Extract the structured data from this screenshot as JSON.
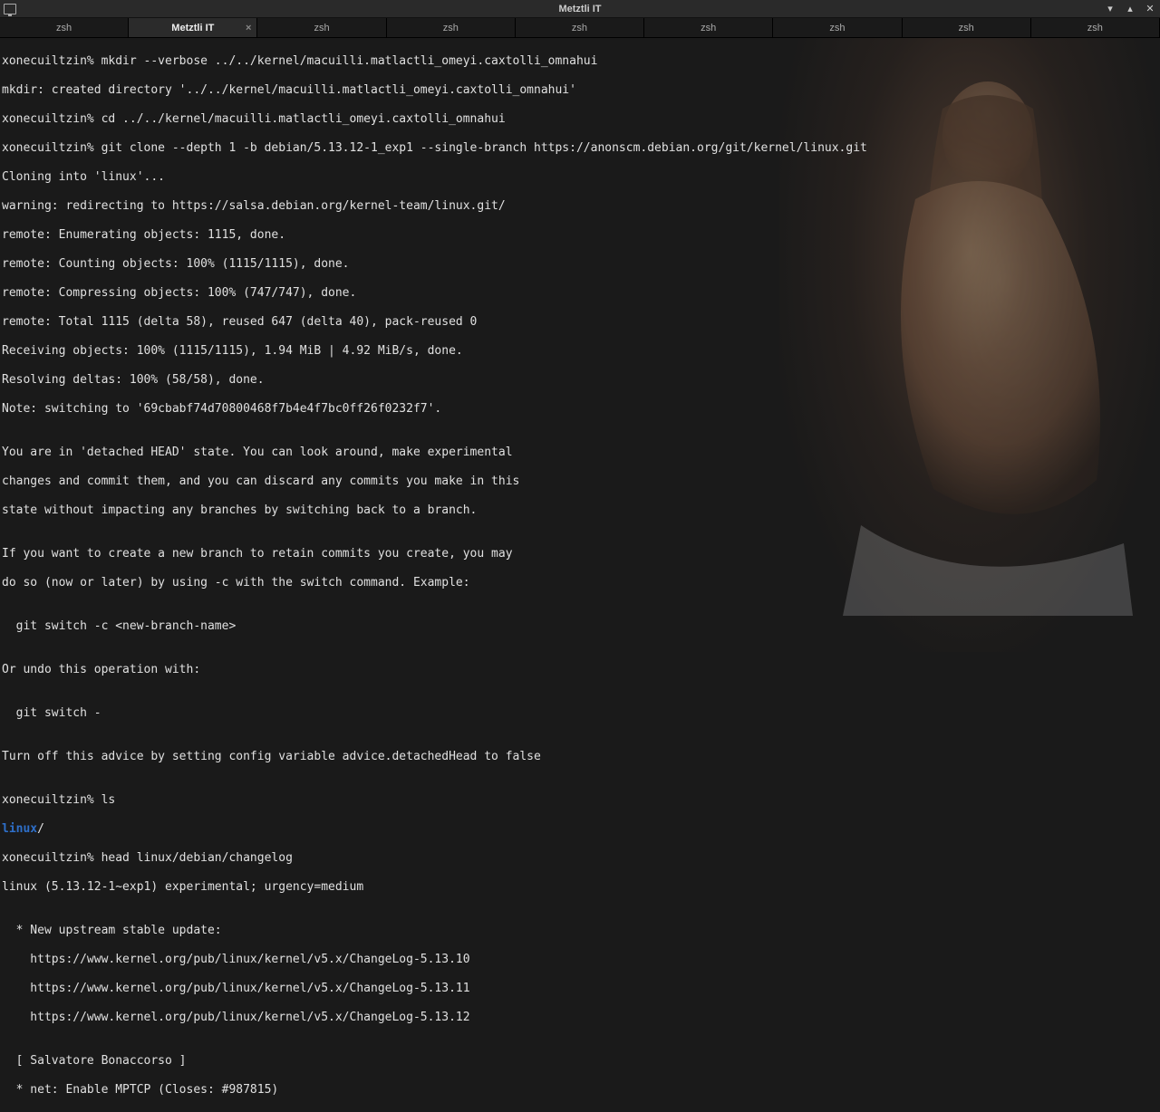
{
  "window": {
    "title": "Metztli IT"
  },
  "tabs": [
    {
      "label": "zsh",
      "active": false
    },
    {
      "label": "Metztli IT",
      "active": true
    },
    {
      "label": "zsh",
      "active": false
    },
    {
      "label": "zsh",
      "active": false
    },
    {
      "label": "zsh",
      "active": false
    },
    {
      "label": "zsh",
      "active": false
    },
    {
      "label": "zsh",
      "active": false
    },
    {
      "label": "zsh",
      "active": false
    },
    {
      "label": "zsh",
      "active": false
    }
  ],
  "term": {
    "l1": "xonecuiltzin% mkdir --verbose ../../kernel/macuilli.matlactli_omeyi.caxtolli_omnahui",
    "l2": "mkdir: created directory '../../kernel/macuilli.matlactli_omeyi.caxtolli_omnahui'",
    "l3": "xonecuiltzin% cd ../../kernel/macuilli.matlactli_omeyi.caxtolli_omnahui",
    "l4": "xonecuiltzin% git clone --depth 1 -b debian/5.13.12-1_exp1 --single-branch https://anonscm.debian.org/git/kernel/linux.git",
    "l5": "Cloning into 'linux'...",
    "l6": "warning: redirecting to https://salsa.debian.org/kernel-team/linux.git/",
    "l7": "remote: Enumerating objects: 1115, done.",
    "l8": "remote: Counting objects: 100% (1115/1115), done.",
    "l9": "remote: Compressing objects: 100% (747/747), done.",
    "l10": "remote: Total 1115 (delta 58), reused 647 (delta 40), pack-reused 0",
    "l11": "Receiving objects: 100% (1115/1115), 1.94 MiB | 4.92 MiB/s, done.",
    "l12": "Resolving deltas: 100% (58/58), done.",
    "l13": "Note: switching to '69cbabf74d70800468f7b4e4f7bc0ff26f0232f7'.",
    "l14": "",
    "l15": "You are in 'detached HEAD' state. You can look around, make experimental",
    "l16": "changes and commit them, and you can discard any commits you make in this",
    "l17": "state without impacting any branches by switching back to a branch.",
    "l18": "",
    "l19": "If you want to create a new branch to retain commits you create, you may",
    "l20": "do so (now or later) by using -c with the switch command. Example:",
    "l21": "",
    "l22": "  git switch -c <new-branch-name>",
    "l23": "",
    "l24": "Or undo this operation with:",
    "l25": "",
    "l26": "  git switch -",
    "l27": "",
    "l28": "Turn off this advice by setting config variable advice.detachedHead to false",
    "l29": "",
    "l30": "xonecuiltzin% ls",
    "l31a": "linux",
    "l31b": "/",
    "l32": "xonecuiltzin% head linux/debian/changelog",
    "l33": "linux (5.13.12-1~exp1) experimental; urgency=medium",
    "l34": "",
    "l35": "  * New upstream stable update:",
    "l36": "    https://www.kernel.org/pub/linux/kernel/v5.x/ChangeLog-5.13.10",
    "l37": "    https://www.kernel.org/pub/linux/kernel/v5.x/ChangeLog-5.13.11",
    "l38": "    https://www.kernel.org/pub/linux/kernel/v5.x/ChangeLog-5.13.12",
    "l39": "",
    "l40": "  [ Salvatore Bonaccorso ]",
    "l41": "  * net: Enable MPTCP (Closes: #987815)"
  }
}
